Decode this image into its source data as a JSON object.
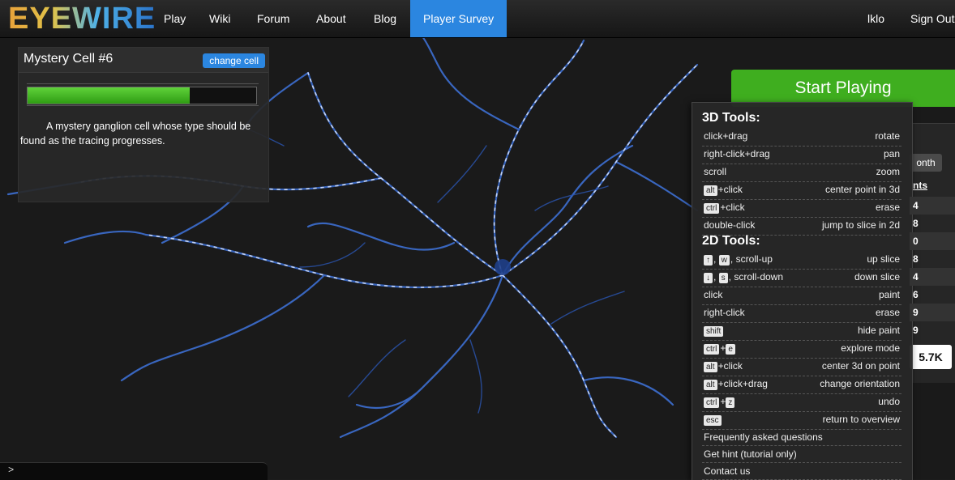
{
  "nav": {
    "logo": "EYEWIRE",
    "items": [
      "Play",
      "Wiki",
      "Forum",
      "About",
      "Blog",
      "Player Survey"
    ],
    "username": "lklo",
    "signout": "Sign Out",
    "accent_color": "#2b86e0"
  },
  "cell": {
    "title": "Mystery Cell #6",
    "change_label": "change cell",
    "progress_fraction": 0.71,
    "description": "A mystery ganglion cell whose type should be found as the tracing progresses."
  },
  "console": {
    "prompt": ">"
  },
  "right": {
    "start_label": "Start Playing",
    "month_label": "onth",
    "points_header": "nts",
    "points": [
      "4",
      "8",
      "0",
      "8",
      "4",
      "6",
      "9",
      "9"
    ],
    "score": "5.7K",
    "start_color": "#3fae1f"
  },
  "help": {
    "section3d": "3D Tools:",
    "tools3d": [
      {
        "keys": [],
        "text": "click+drag",
        "action": "rotate"
      },
      {
        "keys": [],
        "text": "right-click+drag",
        "action": "pan"
      },
      {
        "keys": [],
        "text": "scroll",
        "action": "zoom"
      },
      {
        "keys": [
          "alt"
        ],
        "text": "+click",
        "action": "center point in 3d"
      },
      {
        "keys": [
          "ctrl"
        ],
        "text": "+click",
        "action": "erase"
      },
      {
        "keys": [],
        "text": "double-click",
        "action": "jump to slice in 2d"
      }
    ],
    "section2d": "2D Tools:",
    "tools2d": [
      {
        "keys": [
          "↑",
          "w"
        ],
        "text": ", scroll-up",
        "action": "up slice"
      },
      {
        "keys": [
          "↓",
          "s"
        ],
        "text": ", scroll-down",
        "action": "down slice"
      },
      {
        "keys": [],
        "text": "click",
        "action": "paint"
      },
      {
        "keys": [],
        "text": "right-click",
        "action": "erase"
      },
      {
        "keys": [
          "shift"
        ],
        "text": "",
        "action": "hide paint"
      },
      {
        "keys": [
          "ctrl",
          "e"
        ],
        "text": "",
        "action": "explore mode"
      },
      {
        "keys": [
          "alt"
        ],
        "text": "+click",
        "action": "center 3d on point"
      },
      {
        "keys": [
          "alt"
        ],
        "text": "+click+drag",
        "action": "change orientation"
      },
      {
        "keys": [
          "ctrl",
          "z"
        ],
        "text": "",
        "action": "undo"
      },
      {
        "keys": [
          "esc"
        ],
        "text": "",
        "action": "return to overview"
      }
    ],
    "links": [
      "Frequently asked questions",
      "Get hint (tutorial only)",
      "Contact us"
    ]
  }
}
